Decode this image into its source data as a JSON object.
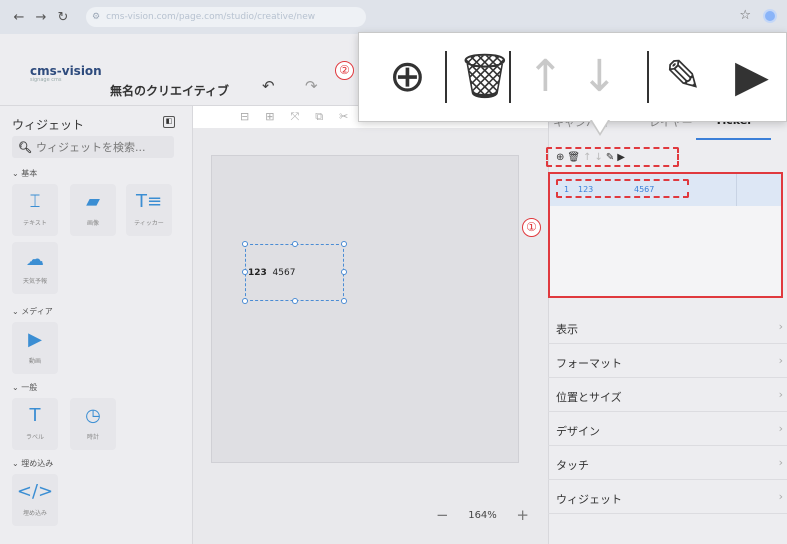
{
  "browser": {
    "url": "cms-vision.com/page.com/studio/creative/new"
  },
  "header": {
    "logo": "cms-vision",
    "logo_tag": "signage cms",
    "title": "無名のクリエイティブ"
  },
  "sidebar": {
    "title": "ウィジェット",
    "search_placeholder": "ウィジェットを検索...",
    "categories": {
      "basic": "基本",
      "media": "メディア",
      "general": "一般",
      "embed": "埋め込み"
    },
    "widgets": {
      "text": "テキスト",
      "image": "画像",
      "ticker": "ティッカー",
      "weather": "天気予報",
      "video": "動画",
      "label": "ラベル",
      "clock": "時計",
      "embed": "埋め込み"
    }
  },
  "canvas": {
    "ticker_num": "123",
    "ticker_text": "4567",
    "zoom": "164%"
  },
  "right_panel": {
    "tabs": [
      "キャンバス",
      "レイヤー",
      "Ticker"
    ],
    "list_row": {
      "index": "1",
      "col_a": "123",
      "col_b": "4567"
    },
    "sections": [
      "表示",
      "フォーマット",
      "位置とサイズ",
      "デザイン",
      "タッチ",
      "ウィジェット"
    ]
  },
  "callouts": {
    "one": "①",
    "two": "②"
  },
  "colors": {
    "accent": "#3b7fd8",
    "callout_red": "#e0393e"
  }
}
